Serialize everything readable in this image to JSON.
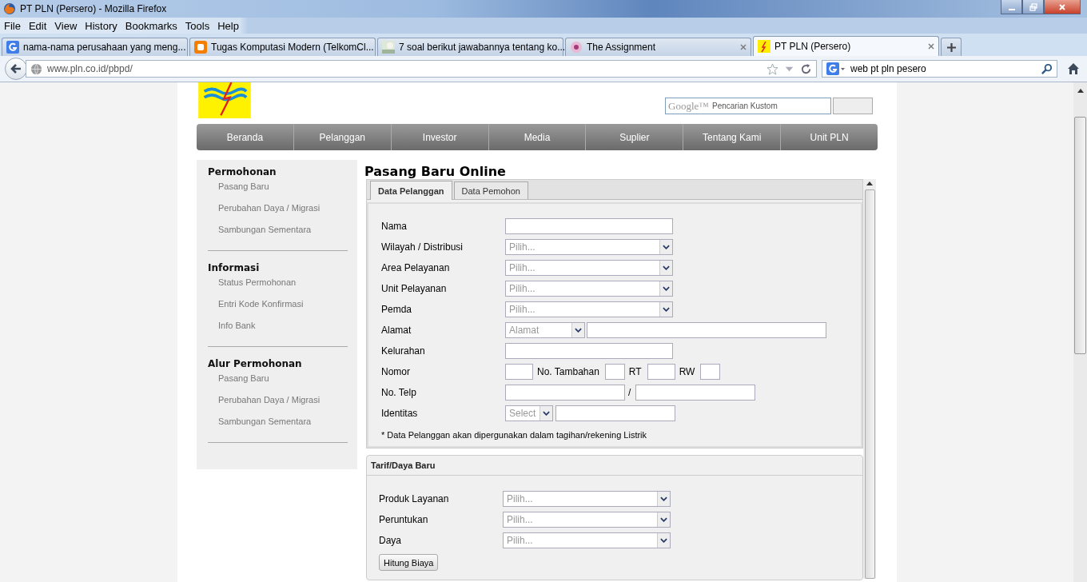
{
  "window": {
    "title": "PT PLN (Persero) - Mozilla Firefox"
  },
  "menu": [
    "File",
    "Edit",
    "View",
    "History",
    "Bookmarks",
    "Tools",
    "Help"
  ],
  "tabs": [
    {
      "title": "nama-nama perusahaan yang meng...",
      "selected": false
    },
    {
      "title": "Tugas Komputasi Modern (TelkomCl...",
      "selected": false
    },
    {
      "title": "7 soal berikut jawabannya tentang ko...",
      "selected": false
    },
    {
      "title": "The Assignment",
      "selected": false
    },
    {
      "title": "PT PLN (Persero)",
      "selected": true
    }
  ],
  "address": {
    "url": "www.pln.co.id/pbpd/"
  },
  "search": {
    "value": "web pt pln pesero"
  },
  "site_search": {
    "brand": "Google™",
    "placeholder": "Pencarian Kustom"
  },
  "nav": [
    "Beranda",
    "Pelanggan",
    "Investor",
    "Media",
    "Suplier",
    "Tentang Kami",
    "Unit PLN"
  ],
  "sidebar": [
    {
      "heading": "Permohonan",
      "items": [
        "Pasang Baru",
        "Perubahan Daya / Migrasi",
        "Sambungan Sementara"
      ]
    },
    {
      "heading": "Informasi",
      "items": [
        "Status Permohonan",
        "Entri Kode Konfirmasi",
        "Info Bank"
      ]
    },
    {
      "heading": "Alur Permohonan",
      "items": [
        "Pasang Baru",
        "Perubahan Daya / Migrasi",
        "Sambungan Sementara"
      ]
    }
  ],
  "form": {
    "title": "Pasang Baru Online",
    "tabs": [
      {
        "label": "Data Pelanggan",
        "selected": true
      },
      {
        "label": "Data Pemohon",
        "selected": false
      }
    ],
    "fields": [
      {
        "label": "Nama",
        "kind": "text"
      },
      {
        "label": "Wilayah / Distribusi",
        "kind": "select",
        "placeholder": "Pilih..."
      },
      {
        "label": "Area Pelayanan",
        "kind": "select",
        "placeholder": "Pilih..."
      },
      {
        "label": "Unit Pelayanan",
        "kind": "select",
        "placeholder": "Pilih..."
      },
      {
        "label": "Pemda",
        "kind": "select",
        "placeholder": "Pilih..."
      },
      {
        "label": "Alamat",
        "kind": "address",
        "placeholder": "Alamat"
      },
      {
        "label": "Kelurahan",
        "kind": "text"
      },
      {
        "label": "Nomor",
        "kind": "numbers",
        "parts": [
          "No. Tambahan",
          "RT",
          "RW"
        ]
      },
      {
        "label": "No. Telp",
        "kind": "phone",
        "separator": "/"
      },
      {
        "label": "Identitas",
        "kind": "identity",
        "placeholder": "Select"
      }
    ],
    "note": "* Data Pelanggan akan dipergunakan dalam tagihan/rekening Listrik"
  },
  "tarif": {
    "title": "Tarif/Daya Baru",
    "fields": [
      {
        "label": "Produk Layanan",
        "placeholder": "Pilih..."
      },
      {
        "label": "Peruntukan",
        "placeholder": "Pilih..."
      },
      {
        "label": "Daya",
        "placeholder": "Pilih..."
      }
    ],
    "button": "Hitung Biaya"
  }
}
